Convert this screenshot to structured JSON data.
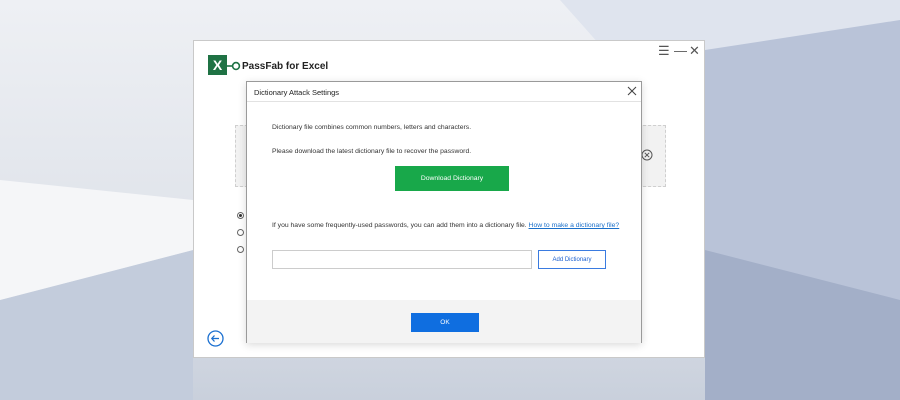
{
  "app": {
    "logo_letter": "X",
    "title": "PassFab for Excel",
    "controls": {
      "menu": "☰",
      "minimize": "—",
      "close": "✕"
    }
  },
  "dialog": {
    "title": "Dictionary Attack Settings",
    "line1": "Dictionary file combines common numbers, letters and characters.",
    "line2": "Please download the latest dictionary file to recover the password.",
    "download_label": "Download Dictionary",
    "info_text": "If you have some frequently-used passwords, you can add them into a dictionary file.",
    "info_link": "How to make a dictionary file?",
    "input_value": "",
    "input_placeholder": "",
    "add_label": "Add Dictionary",
    "ok_label": "OK"
  },
  "background_radios": {
    "selected_index": 0,
    "count": 3
  },
  "colors": {
    "brand_excel": "#1f7244",
    "download_button": "#18a84a",
    "ok_button": "#0f6ee0",
    "link": "#1a6fc9"
  },
  "icons": {
    "logo": "excel-logo-icon",
    "key": "key-icon",
    "dialog_close": "close-icon",
    "clear": "clear-circle-icon",
    "back": "back-arrow-icon"
  }
}
